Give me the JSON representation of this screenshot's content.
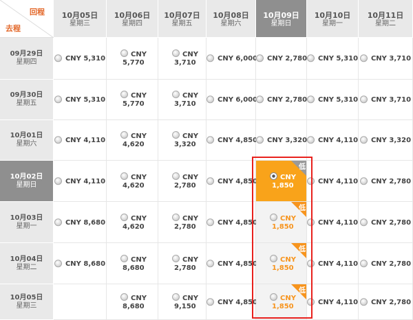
{
  "header": {
    "return_label": "回程",
    "depart_label": "去程",
    "return_dates": [
      {
        "date": "10月05日",
        "weekday": "星期三"
      },
      {
        "date": "10月06日",
        "weekday": "星期四"
      },
      {
        "date": "10月07日",
        "weekday": "星期五"
      },
      {
        "date": "10月08日",
        "weekday": "星期六"
      },
      {
        "date": "10月09日",
        "weekday": "星期日"
      },
      {
        "date": "10月10日",
        "weekday": "星期一"
      },
      {
        "date": "10月11日",
        "weekday": "星期二"
      }
    ],
    "selected_return_index": 4
  },
  "rows": [
    {
      "date": "09月29日",
      "weekday": "星期四",
      "prices": [
        "CNY 5,310",
        "CNY 5,770",
        "CNY 3,710",
        "CNY 6,000",
        "CNY 2,780",
        "CNY 5,310",
        "CNY 3,710"
      ]
    },
    {
      "date": "09月30日",
      "weekday": "星期五",
      "prices": [
        "CNY 5,310",
        "CNY 5,770",
        "CNY 3,710",
        "CNY 6,000",
        "CNY 2,780",
        "CNY 5,310",
        "CNY 3,710"
      ]
    },
    {
      "date": "10月01日",
      "weekday": "星期六",
      "prices": [
        "CNY 4,110",
        "CNY 4,620",
        "CNY 3,320",
        "CNY 4,850",
        "CNY 3,320",
        "CNY 4,110",
        "CNY 3,320"
      ]
    },
    {
      "date": "10月02日",
      "weekday": "星期日",
      "prices": [
        "CNY 4,110",
        "CNY 4,620",
        "CNY 2,780",
        "CNY 4,850",
        "CNY 1,850",
        "CNY 4,110",
        "CNY 2,780"
      ]
    },
    {
      "date": "10月03日",
      "weekday": "星期一",
      "prices": [
        "CNY 8,680",
        "CNY 4,620",
        "CNY 2,780",
        "CNY 4,850",
        "CNY 1,850",
        "CNY 4,110",
        "CNY 2,780"
      ]
    },
    {
      "date": "10月04日",
      "weekday": "星期二",
      "prices": [
        "CNY 8,680",
        "CNY 8,680",
        "CNY 2,780",
        "CNY 4,850",
        "CNY 1,850",
        "CNY 4,110",
        "CNY 2,780"
      ]
    },
    {
      "date": "10月05日",
      "weekday": "星期三",
      "prices": [
        "",
        "CNY 8,680",
        "CNY 9,150",
        "CNY 4,850",
        "CNY 1,850",
        "CNY 4,110",
        "CNY 2,780"
      ]
    }
  ],
  "selected_depart_index": 3,
  "low_badge_label": "低",
  "low_cells": [
    [
      3,
      4
    ],
    [
      4,
      4
    ],
    [
      5,
      4
    ],
    [
      6,
      4
    ]
  ],
  "selected_cell": [
    3,
    4
  ],
  "colors": {
    "accent": "#f7941d",
    "highlight_border": "#e8201c",
    "header_bg": "#e9e9e9",
    "selected_header_bg": "#8f8f8f"
  }
}
